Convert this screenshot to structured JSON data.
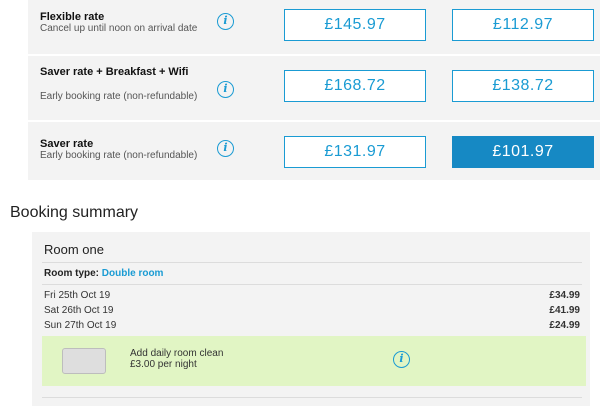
{
  "rates": [
    {
      "name": "Flexible rate",
      "desc": "Cancel up until noon on arrival date",
      "price1": "£145.97",
      "price2": "£112.97"
    },
    {
      "name": "Saver rate + Breakfast + Wifi",
      "desc": "Early booking rate (non-refundable)",
      "price1": "£168.72",
      "price2": "£138.72"
    },
    {
      "name": "Saver rate",
      "desc": "Early booking rate (non-refundable)",
      "price1": "£131.97",
      "price2": "£101.97"
    }
  ],
  "info_glyph": "i",
  "summary": {
    "title": "Booking summary",
    "room_heading": "Room one",
    "room_type_label": "Room type:",
    "room_type_value": "Double room",
    "nights": [
      {
        "date": "Fri 25th Oct 19",
        "amount": "£34.99"
      },
      {
        "date": "Sat 26th Oct 19",
        "amount": "£41.99"
      },
      {
        "date": "Sun 27th Oct 19",
        "amount": "£24.99"
      }
    ],
    "addon_line1": "Add daily room clean",
    "addon_line2": "£3.00 per night"
  },
  "colors": {
    "accent": "#1a9bd3",
    "selected": "#1689c4",
    "addon_bg": "#e1f5c4",
    "panel_bg": "#f3f3f3"
  }
}
